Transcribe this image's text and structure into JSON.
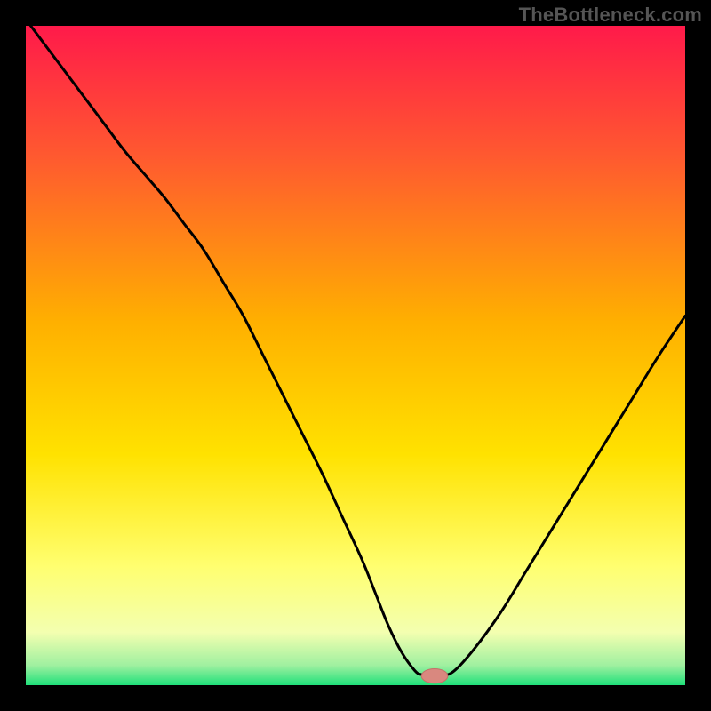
{
  "watermark": "TheBottleneck.com",
  "colors": {
    "frame": "#000000",
    "gradient_top": "#ff1a4a",
    "gradient_mid1": "#ff6a2a",
    "gradient_mid2": "#ffd400",
    "gradient_mid3": "#ffff70",
    "gradient_mid4": "#f7ffb0",
    "gradient_bottom": "#1fe07a",
    "curve": "#000000",
    "marker_fill": "#d9887f",
    "marker_stroke": "#c57068"
  },
  "chart_data": {
    "type": "line",
    "title": "",
    "xlabel": "",
    "ylabel": "",
    "xlim": [
      0,
      100
    ],
    "ylim": [
      0,
      100
    ],
    "legend": false,
    "grid": false,
    "series": [
      {
        "name": "bottleneck-curve",
        "x": [
          0,
          3,
          6,
          9,
          12,
          15,
          18,
          21,
          24,
          27,
          30,
          33,
          36,
          39,
          42,
          45,
          48,
          51,
          53,
          55,
          57,
          59,
          60,
          61,
          63,
          65,
          68,
          72,
          76,
          80,
          84,
          88,
          92,
          96,
          100
        ],
        "y": [
          101,
          97,
          93,
          89,
          85,
          81,
          77.5,
          74,
          70,
          66,
          61,
          56,
          50,
          44,
          38,
          32,
          25.5,
          19,
          14,
          9,
          5,
          2.2,
          1.6,
          1.4,
          1.4,
          2.2,
          5.5,
          11,
          17.5,
          24,
          30.5,
          37,
          43.5,
          50,
          56
        ]
      }
    ],
    "marker": {
      "x": 62,
      "y": 1.4,
      "rx": 2.0,
      "ry": 1.1
    },
    "gradient_stops": [
      {
        "offset": 0.0,
        "color": "#ff1a4a"
      },
      {
        "offset": 0.2,
        "color": "#ff5a2f"
      },
      {
        "offset": 0.45,
        "color": "#ffb000"
      },
      {
        "offset": 0.65,
        "color": "#ffe200"
      },
      {
        "offset": 0.82,
        "color": "#ffff70"
      },
      {
        "offset": 0.92,
        "color": "#f3ffb0"
      },
      {
        "offset": 0.97,
        "color": "#9ff0a0"
      },
      {
        "offset": 1.0,
        "color": "#1fe07a"
      }
    ]
  }
}
